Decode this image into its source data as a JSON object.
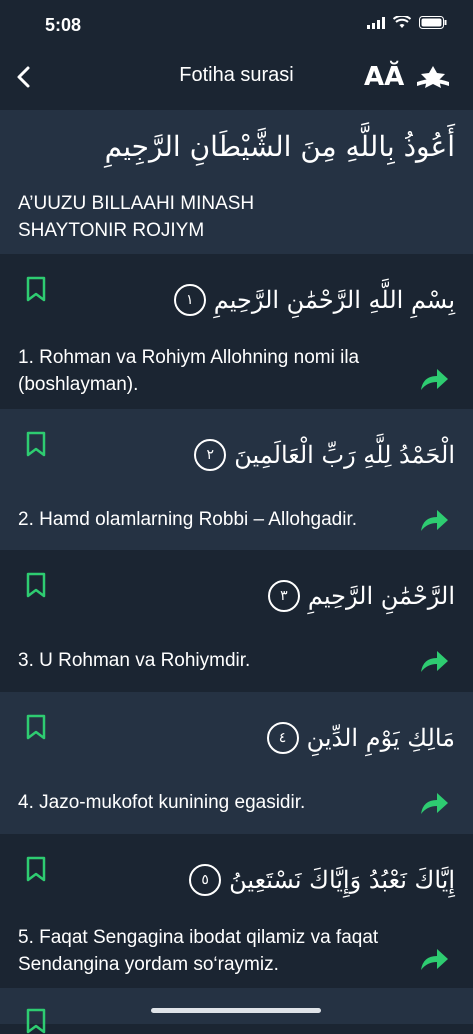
{
  "status": {
    "time": "5:08"
  },
  "nav": {
    "title": "Fotiha surasi",
    "font_label": "AĂ"
  },
  "header": {
    "arabic": "أَعُوذُ بِاللَّهِ مِنَ الشَّيْطَانِ الرَّجِيمِ",
    "text": "A’UUZU BILLAAHI MINASH SHAYTONIR ROJIYM"
  },
  "ayahs": [
    {
      "arabic": "بِسْمِ اللَّهِ الرَّحْمَٰنِ الرَّحِيمِ",
      "number": "١",
      "translation": "1. Rohman va Rohiym Allohning nomi ila (boshlayman)."
    },
    {
      "arabic": "الْحَمْدُ لِلَّهِ رَبِّ الْعَالَمِينَ",
      "number": "٢",
      "translation": "2. Hamd olamlarning Robbi – Allohgadir."
    },
    {
      "arabic": "الرَّحْمَٰنِ الرَّحِيمِ",
      "number": "٣",
      "translation": "3. U Rohman va Rohiymdir."
    },
    {
      "arabic": "مَالِكِ يَوْمِ الدِّينِ",
      "number": "٤",
      "translation": "4. Jazo-mukofot kunining egasidir."
    },
    {
      "arabic": "إِيَّاكَ نَعْبُدُ وَإِيَّاكَ نَسْتَعِينُ",
      "number": "٥",
      "translation": "5. Faqat Sengagina ibodat qilamiz va faqat Sendangina yordam so‘raymiz."
    }
  ],
  "colors": {
    "bg": "#1b2532",
    "alt_bg": "#253243",
    "accent": "#2ecc71"
  }
}
